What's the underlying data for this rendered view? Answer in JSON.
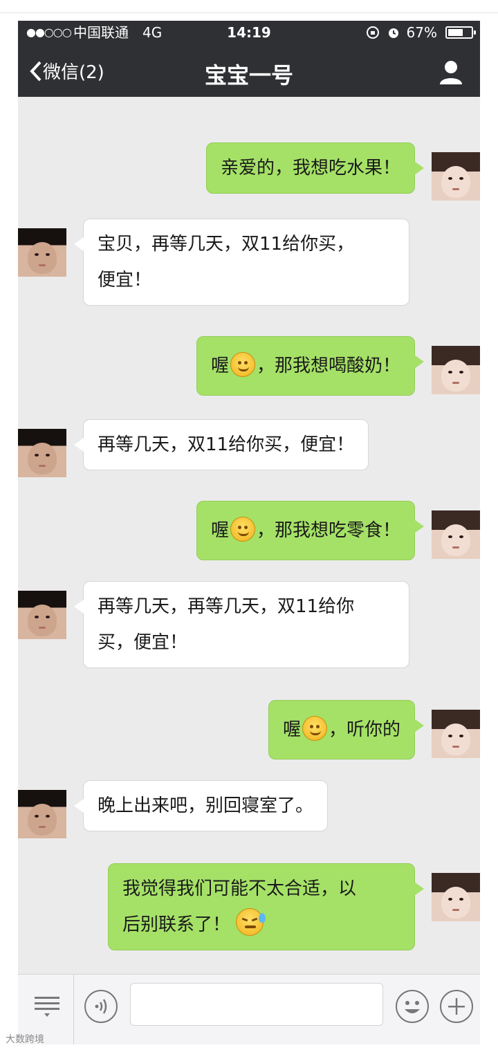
{
  "status_bar": {
    "signal": "●●○○○",
    "carrier": "中国联通",
    "network": "4G",
    "time": "14:19",
    "battery": "67%",
    "battery_level": 0.67
  },
  "nav": {
    "back_label": "微信(2)",
    "title": "宝宝一号",
    "profile_icon": "person-icon"
  },
  "messages": [
    {
      "side": "out",
      "text": "亲爱的，我想吃水果！"
    },
    {
      "side": "in",
      "line1": "宝贝，再等几天，双11给你买，",
      "line2": "便宜！"
    },
    {
      "side": "out",
      "pre": "喔",
      "emoji": "smile-emoji",
      "post": "，那我想喝酸奶！"
    },
    {
      "side": "in",
      "text": "再等几天，双11给你买，便宜！"
    },
    {
      "side": "out",
      "pre": "喔",
      "emoji": "smile-emoji",
      "post": "，那我想吃零食！"
    },
    {
      "side": "in",
      "line1": "再等几天，再等几天，双11给你",
      "line2": "买，便宜！"
    },
    {
      "side": "out",
      "pre": "喔",
      "emoji": "smile-emoji",
      "post": "，听你的"
    },
    {
      "side": "in",
      "text": "晚上出来吧，别回寝室了。"
    },
    {
      "side": "out",
      "line1": "我觉得我们可能不太合适，以",
      "line2": "后别联系了！",
      "emoji": "sweat-emoji"
    }
  ],
  "input_bar": {
    "menu_icon": "menu-icon",
    "voice_icon": "voice-icon",
    "text_value": "",
    "emoji_icon": "emoji-icon",
    "plus_icon": "plus-icon"
  },
  "watermark": "大数跨境",
  "colors": {
    "header_bg": "#2e3033",
    "chat_bg": "#ebebeb",
    "outgoing_bubble": "#a5e167",
    "incoming_bubble": "#ffffff"
  }
}
